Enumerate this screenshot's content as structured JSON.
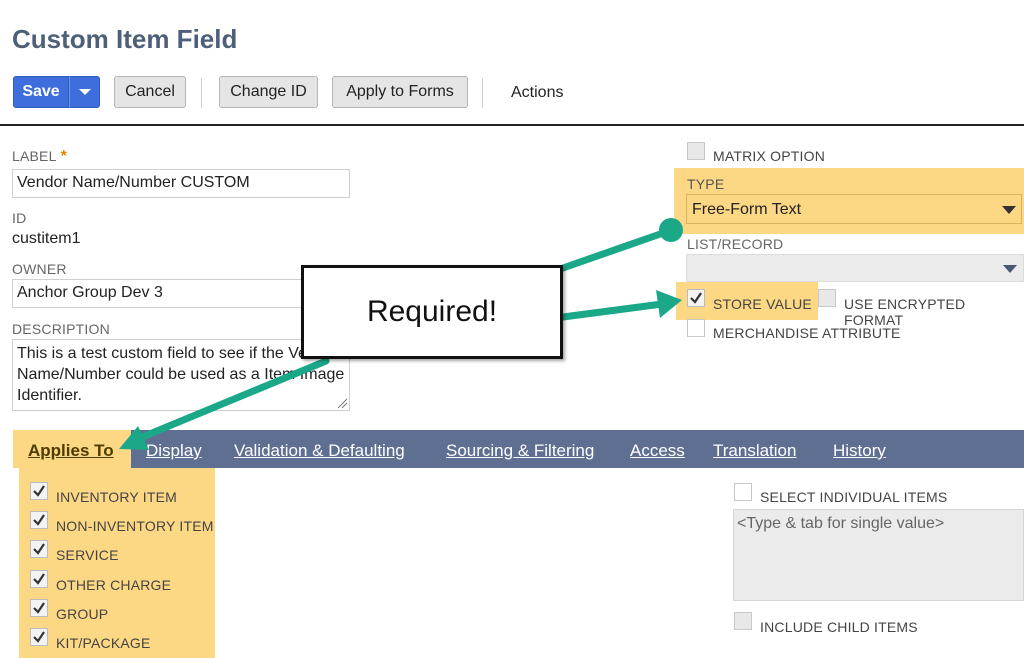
{
  "page": {
    "title": "Custom Item Field"
  },
  "toolbar": {
    "save_label": "Save",
    "cancel_label": "Cancel",
    "change_id_label": "Change ID",
    "apply_to_forms_label": "Apply to Forms",
    "actions_label": "Actions"
  },
  "form": {
    "label_label": "LABEL",
    "label_value": "Vendor Name/Number CUSTOM",
    "required_marker": "*",
    "id_label": "ID",
    "id_value": "custitem1",
    "owner_label": "OWNER",
    "owner_value": "Anchor Group Dev 3",
    "description_label": "DESCRIPTION",
    "description_value": "This is a test custom field to see if the Vendor Name/Number could be used as a Item Image Identifier."
  },
  "right": {
    "matrix_option": "MATRIX OPTION",
    "type_label": "TYPE",
    "type_value": "Free-Form Text",
    "list_record_label": "LIST/RECORD",
    "list_record_value": "",
    "store_value": "STORE VALUE",
    "store_value_checked": true,
    "use_encrypted_format": "USE ENCRYPTED FORMAT",
    "merchandise_attribute": "MERCHANDISE ATTRIBUTE"
  },
  "tabs": [
    {
      "label": "Applies To",
      "active": true
    },
    {
      "label": "Display",
      "active": false
    },
    {
      "label": "Validation & Defaulting",
      "active": false
    },
    {
      "label": "Sourcing & Filtering",
      "active": false
    },
    {
      "label": "Access",
      "active": false
    },
    {
      "label": "Translation",
      "active": false
    },
    {
      "label": "History",
      "active": false
    }
  ],
  "applies_to": [
    {
      "label": "INVENTORY ITEM",
      "checked": true
    },
    {
      "label": "NON-INVENTORY ITEM",
      "checked": true
    },
    {
      "label": "SERVICE",
      "checked": true
    },
    {
      "label": "OTHER CHARGE",
      "checked": true
    },
    {
      "label": "GROUP",
      "checked": true
    },
    {
      "label": "KIT/PACKAGE",
      "checked": true
    }
  ],
  "select_items": {
    "select_individual": "SELECT INDIVIDUAL ITEMS",
    "placeholder": "<Type & tab for single value>",
    "include_child": "INCLUDE CHILD ITEMS"
  },
  "annotation": {
    "callout_text": "Required!"
  },
  "colors": {
    "highlight": "#fcd784",
    "primary_button": "#3d6edc",
    "tab_bar": "#5e6f91",
    "arrow": "#1aa889",
    "title": "#4d5f79"
  }
}
